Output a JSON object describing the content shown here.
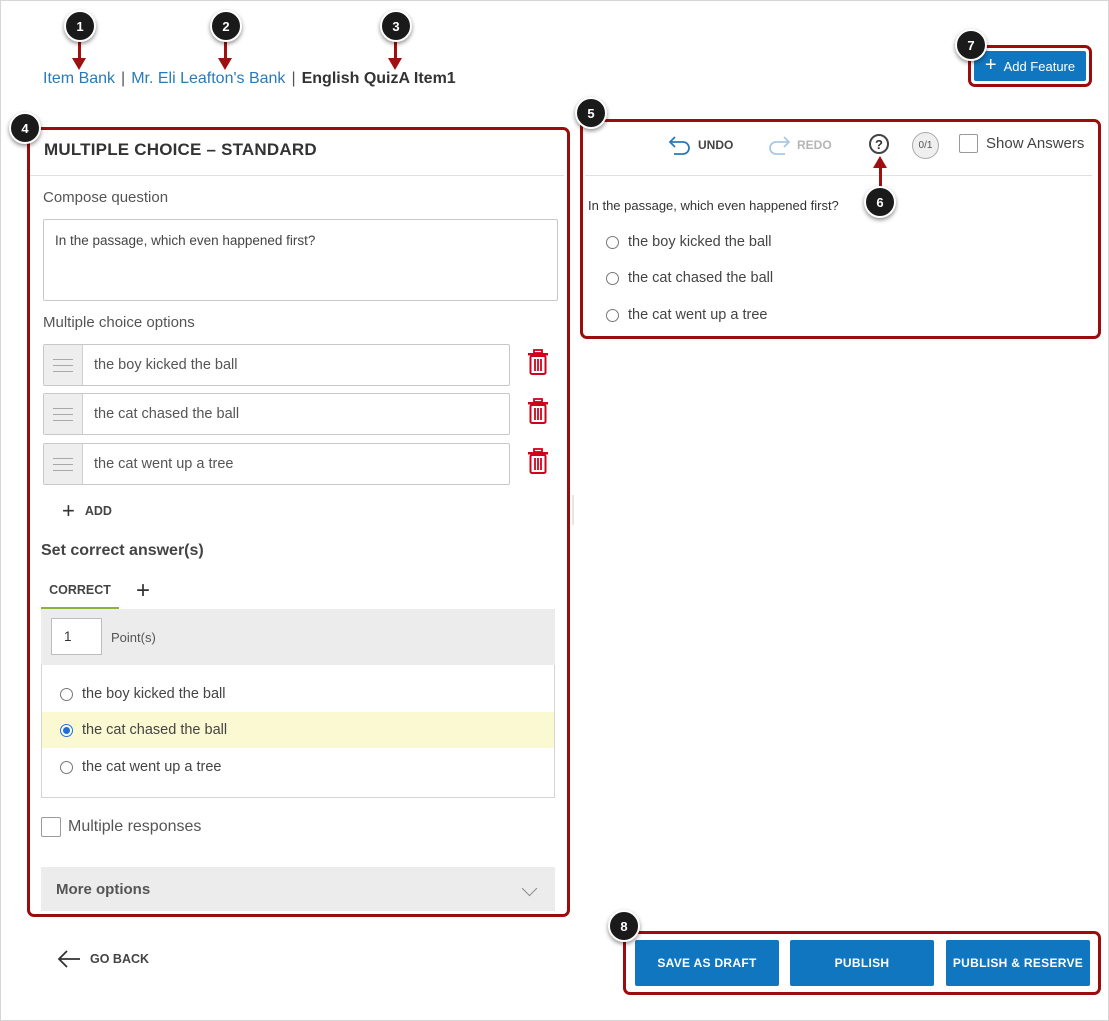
{
  "breadcrumb": {
    "item_bank": "Item Bank",
    "bank": "Mr. Eli Leafton's Bank",
    "separator": "|",
    "current": "English QuizA Item1"
  },
  "header": {
    "add_feature_label": "Add Feature"
  },
  "editor": {
    "panel_title": "MULTIPLE CHOICE – STANDARD",
    "compose_label": "Compose question",
    "question_text": "In the passage, which even happened first?",
    "options_label": "Multiple choice options",
    "options": [
      "the boy kicked the ball",
      "the cat chased the ball",
      "the cat went up a tree"
    ],
    "add_label": "ADD",
    "correct_heading": "Set correct answer(s)",
    "correct_tab": "CORRECT",
    "points_value": "1",
    "points_label": "Point(s)",
    "correct_answers": [
      {
        "label": "the boy kicked the ball",
        "selected": false
      },
      {
        "label": "the cat chased the ball",
        "selected": true
      },
      {
        "label": "the cat went up a tree",
        "selected": false
      }
    ],
    "multiple_responses_label": "Multiple responses",
    "more_options_label": "More options"
  },
  "preview": {
    "undo_label": "UNDO",
    "redo_label": "REDO",
    "score": "0/1",
    "help_symbol": "?",
    "show_answers_label": "Show Answers",
    "question_text": "In the passage, which even happened first?",
    "options": [
      "the boy kicked the ball",
      "the cat chased the ball",
      "the cat went up a tree"
    ]
  },
  "footer": {
    "go_back_label": "GO BACK",
    "save_draft_label": "SAVE AS DRAFT",
    "publish_label": "PUBLISH",
    "publish_reserve_label": "PUBLISH & RESERVE"
  },
  "callouts": [
    "1",
    "2",
    "3",
    "4",
    "5",
    "6",
    "7",
    "8"
  ],
  "colors": {
    "primary": "#1176c0",
    "link": "#2a7ab8",
    "callout_highlight": "#9b0d0d",
    "delete": "#d0021b",
    "tab_underline": "#8bb33b",
    "selected_row": "#fbf9d1"
  },
  "icons": [
    "drag-handle-icon",
    "trash-icon",
    "plus-icon",
    "undo-icon",
    "redo-icon",
    "help-icon",
    "chevron-down-icon",
    "arrow-left-icon"
  ]
}
